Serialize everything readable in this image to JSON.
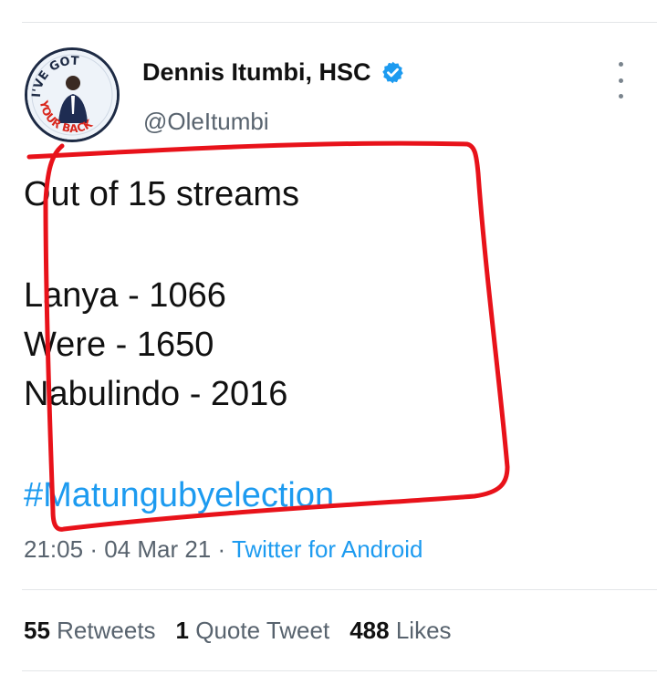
{
  "author": {
    "name": "Dennis Itumbi, HSC",
    "handle": "@OleItumbi",
    "avatar_text_top": "I'VE GOT",
    "avatar_text_bottom": "YOUR BACK"
  },
  "tweet": {
    "line1": "Out of 15 streams",
    "results": [
      "Lanya - 1066",
      "Were - 1650",
      "Nabulindo - 2016"
    ],
    "hashtag": "#Matungubyelection",
    "time": "21:05",
    "date": "04 Mar 21",
    "source": "Twitter for Android"
  },
  "stats": {
    "retweets_count": "55",
    "retweets_label": "Retweets",
    "quote_count": "1",
    "quote_label": "Quote Tweet",
    "likes_count": "488",
    "likes_label": "Likes"
  },
  "colors": {
    "link": "#1d9bf0",
    "annotation": "#e8121a",
    "verified": "#1d9bf0"
  }
}
